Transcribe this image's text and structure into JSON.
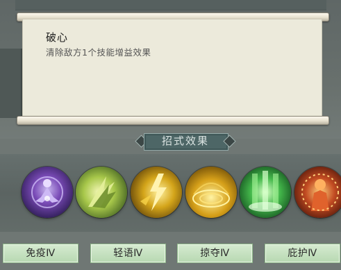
{
  "skill": {
    "name": "破心",
    "description": "清除敌方1个技能增益效果"
  },
  "section_title": "招式效果",
  "effect_icons": [
    {
      "icon": "meditating-figure-icon",
      "color": "#7a4bb7"
    },
    {
      "icon": "green-blade-icon",
      "color": "#a7c74a"
    },
    {
      "icon": "golden-lightning-icon",
      "color": "#d4a51a"
    },
    {
      "icon": "golden-shield-icon",
      "color": "#d6a019"
    },
    {
      "icon": "green-aura-icon",
      "color": "#44b84b"
    },
    {
      "icon": "fiery-figure-icon",
      "color": "#c24b22"
    }
  ],
  "tags": [
    "免疫Ⅳ",
    "轻语Ⅳ",
    "掠夺Ⅳ",
    "庇护Ⅳ"
  ]
}
